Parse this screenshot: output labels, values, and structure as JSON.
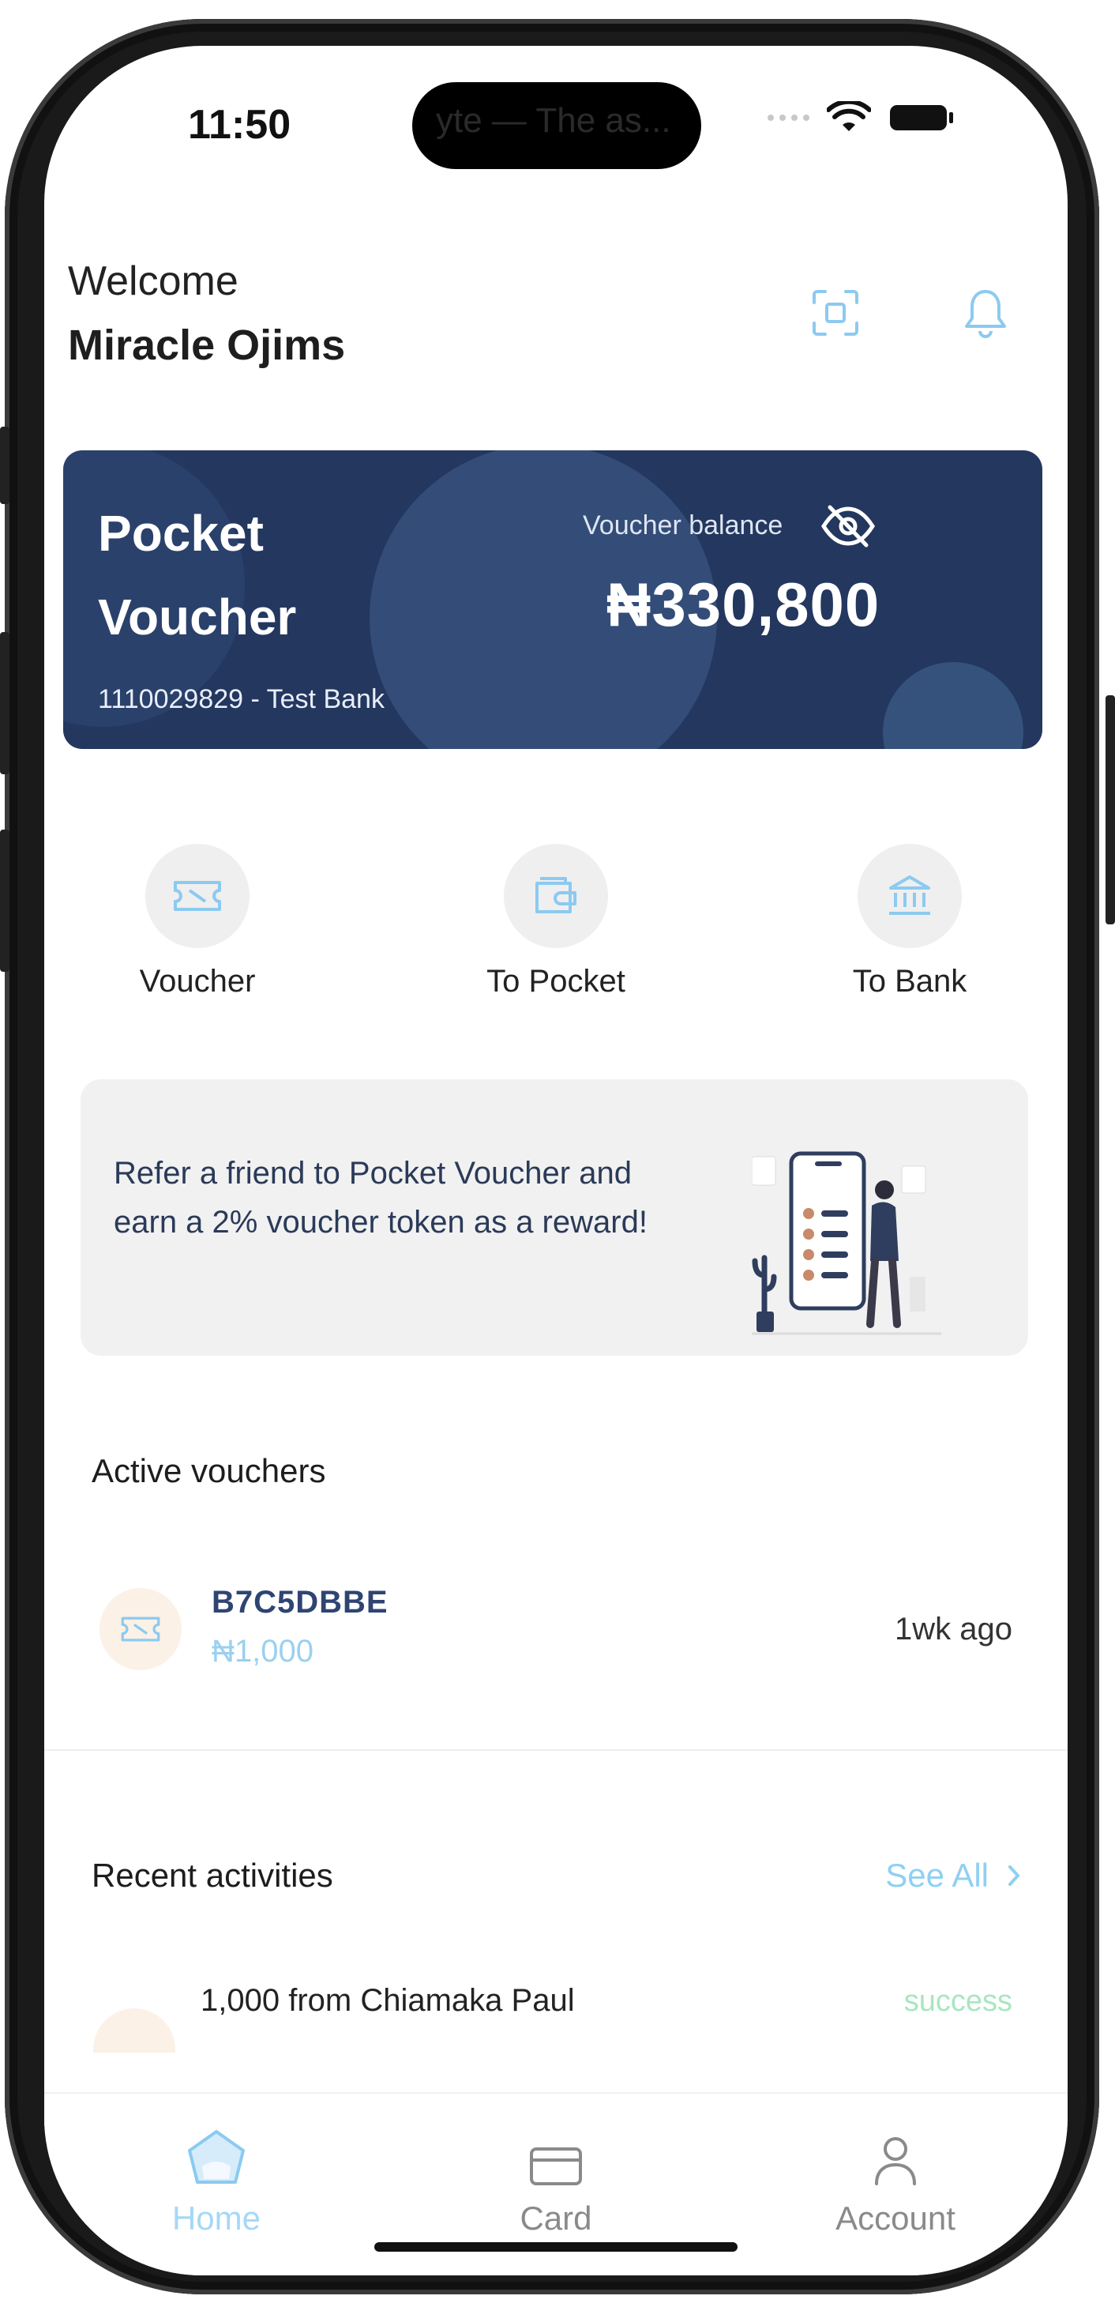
{
  "status_bar": {
    "time": "11:50",
    "island_text": "yte — The as..."
  },
  "header": {
    "greeting": "Welcome",
    "user_name": "Miracle Ojims"
  },
  "balance_card": {
    "brand": "Pocket Voucher",
    "balance_label": "Voucher balance",
    "balance": "₦330,800",
    "account": "1110029829 - Test Bank"
  },
  "actions": [
    {
      "label": "Voucher",
      "icon": "ticket-icon"
    },
    {
      "label": "To Pocket",
      "icon": "wallet-icon"
    },
    {
      "label": "To Bank",
      "icon": "bank-icon"
    }
  ],
  "promo": {
    "text": "Refer a friend to Pocket Voucher and earn a 2% voucher token as a reward!"
  },
  "active_vouchers": {
    "title": "Active vouchers",
    "items": [
      {
        "code": "B7C5DBBE",
        "amount": "₦1,000",
        "time": "1wk ago"
      }
    ]
  },
  "recent_activities": {
    "title": "Recent activities",
    "see_all": "See All",
    "items": [
      {
        "text": "1,000 from Chiamaka Paul",
        "status": "success"
      }
    ]
  },
  "tabs": [
    {
      "label": "Home",
      "icon": "home-icon",
      "active": true
    },
    {
      "label": "Card",
      "icon": "card-icon",
      "active": false
    },
    {
      "label": "Account",
      "icon": "user-icon",
      "active": false
    }
  ],
  "colors": {
    "card_bg": "#23375f",
    "accent": "#8fd0f3",
    "icon_blue": "#8ccaf0",
    "success": "#a8e6c0",
    "promo_bg": "#f1f1f1"
  }
}
